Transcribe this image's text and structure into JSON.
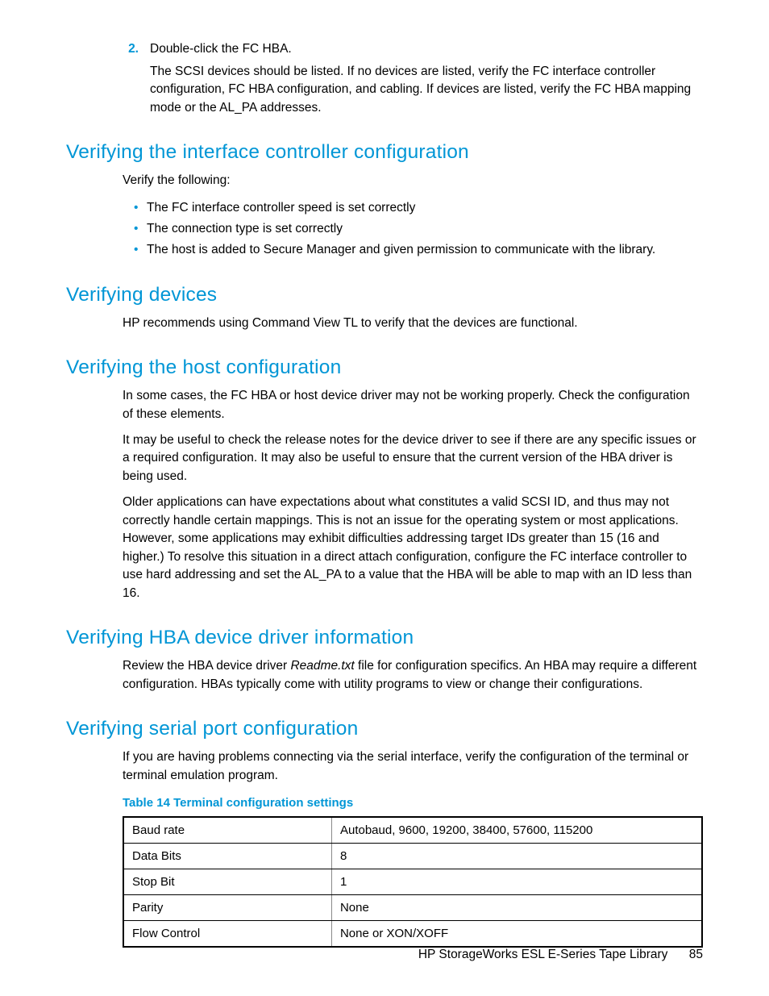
{
  "step": {
    "num": "2.",
    "action": "Double-click the FC HBA.",
    "detail": "The SCSI devices should be listed. If no devices are listed, verify the FC interface controller configuration, FC HBA configuration, and cabling. If devices are listed, verify the FC HBA mapping mode or the AL_PA addresses."
  },
  "sections": {
    "ifc": {
      "title": "Verifying the interface controller configuration",
      "intro": "Verify the following:",
      "bullets": [
        "The FC interface controller speed is set correctly",
        "The connection type is set correctly",
        "The host is added to Secure Manager and given permission to communicate with the library."
      ]
    },
    "devices": {
      "title": "Verifying devices",
      "para": "HP recommends using Command View TL to verify that the devices are functional."
    },
    "host": {
      "title": "Verifying the host configuration",
      "p1": "In some cases, the FC HBA or host device driver may not be working properly. Check the configuration of these elements.",
      "p2": "It may be useful to check the release notes for the device driver to see if there are any specific issues or a required configuration. It may also be useful to ensure that the current version of the HBA driver is being used.",
      "p3": "Older applications can have expectations about what constitutes a valid SCSI ID, and thus may not correctly handle certain mappings. This is not an issue for the operating system or most applications. However, some applications may exhibit difficulties addressing target IDs greater than 15 (16 and higher.) To resolve this situation in a direct attach configuration, configure the FC interface controller to use hard addressing and set the AL_PA to a value that the HBA will be able to map with an ID less than 16."
    },
    "hba": {
      "title": "Verifying HBA device driver information",
      "pre": "Review the HBA device driver ",
      "file": "Readme.txt",
      "post": " file for configuration specifics. An HBA may require a different configuration. HBAs typically come with utility programs to view or change their configurations."
    },
    "serial": {
      "title": "Verifying serial port configuration",
      "para": "If you are having problems connecting via the serial interface, verify the configuration of the terminal or terminal emulation program.",
      "table_caption": "Table 14 Terminal configuration settings",
      "rows": [
        {
          "k": "Baud rate",
          "v": "Autobaud, 9600, 19200, 38400, 57600, 115200"
        },
        {
          "k": "Data Bits",
          "v": "8"
        },
        {
          "k": "Stop Bit",
          "v": "1"
        },
        {
          "k": "Parity",
          "v": "None"
        },
        {
          "k": "Flow Control",
          "v": "None or XON/XOFF"
        }
      ]
    }
  },
  "footer": {
    "title": "HP StorageWorks ESL E-Series Tape Library",
    "page": "85"
  }
}
